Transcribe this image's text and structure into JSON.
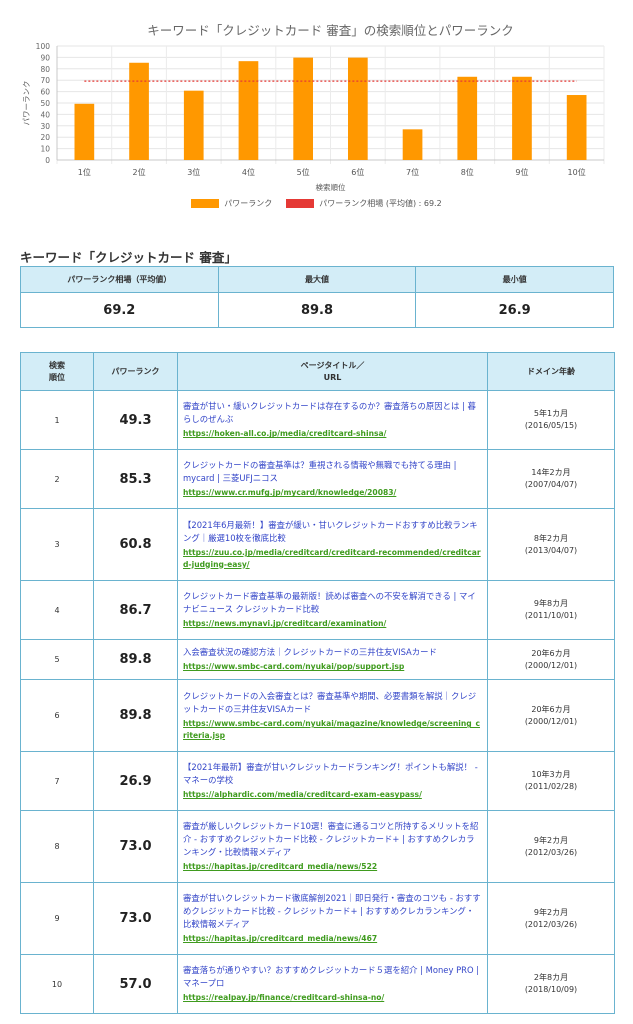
{
  "colors": {
    "bar": "#ff9800",
    "average_line": "#e53935",
    "header_bg": "#d3edf7",
    "border": "#6ab3cf",
    "title_link": "#3345c8",
    "url_link": "#3f9b1e"
  },
  "chart_data": {
    "type": "bar",
    "title": "キーワード「クレジットカード 審査」の検索順位とパワーランク",
    "xlabel": "検索順位",
    "ylabel": "パワーランク",
    "categories": [
      "1位",
      "2位",
      "3位",
      "4位",
      "5位",
      "6位",
      "7位",
      "8位",
      "9位",
      "10位"
    ],
    "series": [
      {
        "name": "パワーランク",
        "type": "bar",
        "values": [
          49.3,
          85.3,
          60.8,
          86.7,
          89.8,
          89.8,
          26.9,
          73.0,
          73.0,
          57.0
        ]
      },
      {
        "name": "パワーランク相場 (平均値) : 69.2",
        "type": "line",
        "value": 69.2
      }
    ],
    "ylim": [
      0,
      100
    ],
    "yticks": [
      0,
      10,
      20,
      30,
      40,
      50,
      60,
      70,
      80,
      90,
      100
    ],
    "grid": true,
    "legend_position": "bottom"
  },
  "summary": {
    "heading": "キーワード「クレジットカード 審査」",
    "headers": [
      "パワーランク相場（平均値）",
      "最大値",
      "最小値"
    ],
    "values": [
      "69.2",
      "89.8",
      "26.9"
    ]
  },
  "ranking": {
    "headers": {
      "rank_line1": "検索",
      "rank_line2": "順位",
      "power": "パワーランク",
      "title_line1": "ページタイトル／",
      "title_line2": "URL",
      "age": "ドメイン年齢"
    },
    "rows": [
      {
        "rank": "1",
        "power": "49.3",
        "title": "審査が甘い・緩いクレジットカードは存在するのか？審査落ちの原因とは | 暮らしのぜんぶ",
        "url": "https://hoken-all.co.jp/media/creditcard-shinsa/",
        "age_years": "5年1カ月",
        "age_date": "(2016/05/15)"
      },
      {
        "rank": "2",
        "power": "85.3",
        "title": "クレジットカードの審査基準は？重視される情報や無職でも持てる理由 | mycard | 三菱UFJニコス",
        "url": "https://www.cr.mufg.jp/mycard/knowledge/20083/",
        "age_years": "14年2カ月",
        "age_date": "(2007/04/07)"
      },
      {
        "rank": "3",
        "power": "60.8",
        "title": "【2021年6月最新！】審査が緩い・甘いクレジットカードおすすめ比較ランキング｜厳選10枚を徹底比較",
        "url": "https://zuu.co.jp/media/creditcard/creditcard-recommended/creditcard-judging-easy/",
        "age_years": "8年2カ月",
        "age_date": "(2013/04/07)"
      },
      {
        "rank": "4",
        "power": "86.7",
        "title": "クレジットカード審査基準の最新版！読めば審査への不安を解消できる | マイナビニュース クレジットカード比較",
        "url": "https://news.mynavi.jp/creditcard/examination/",
        "age_years": "9年8カ月",
        "age_date": "(2011/10/01)"
      },
      {
        "rank": "5",
        "power": "89.8",
        "title": "入会審査状況の確認方法｜クレジットカードの三井住友VISAカード",
        "url": "https://www.smbc-card.com/nyukai/pop/support.jsp",
        "age_years": "20年6カ月",
        "age_date": "(2000/12/01)"
      },
      {
        "rank": "6",
        "power": "89.8",
        "title": "クレジットカードの入会審査とは？審査基準や期間、必要書類を解説｜クレジットカードの三井住友VISAカード",
        "url": "https://www.smbc-card.com/nyukai/magazine/knowledge/screening_criteria.jsp",
        "age_years": "20年6カ月",
        "age_date": "(2000/12/01)"
      },
      {
        "rank": "7",
        "power": "26.9",
        "title": "【2021年最新】審査が甘いクレジットカードランキング！ポイントも解説！ - マネーの学校",
        "url": "https://alphardic.com/media/creditcard-exam-easypass/",
        "age_years": "10年3カ月",
        "age_date": "(2011/02/28)"
      },
      {
        "rank": "8",
        "power": "73.0",
        "title": "審査が厳しいクレジットカード10選！審査に通るコツと所持するメリットを紹介 - おすすめクレジットカード比較 - クレジットカード+ | おすすめクレカランキング・比較情報メディア",
        "url": "https://hapitas.jp/creditcard_media/news/522",
        "age_years": "9年2カ月",
        "age_date": "(2012/03/26)"
      },
      {
        "rank": "9",
        "power": "73.0",
        "title": "審査が甘いクレジットカード徹底解剖2021｜即日発行・審査のコツも - おすすめクレジットカード比較 - クレジットカード+ | おすすめクレカランキング・比較情報メディア",
        "url": "https://hapitas.jp/creditcard_media/news/467",
        "age_years": "9年2カ月",
        "age_date": "(2012/03/26)"
      },
      {
        "rank": "10",
        "power": "57.0",
        "title": "審査落ちが通りやすい？おすすめクレジットカード５選を紹介 | Money PRO | マネープロ",
        "url": "https://realpay.jp/finance/creditcard-shinsa-no/",
        "age_years": "2年8カ月",
        "age_date": "(2018/10/09)"
      }
    ]
  }
}
